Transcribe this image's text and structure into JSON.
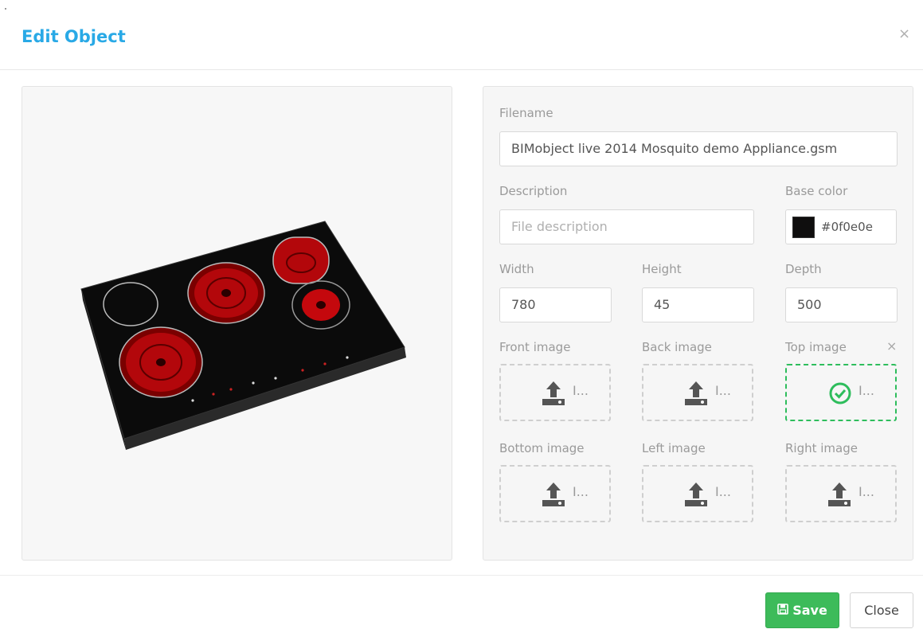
{
  "dialog": {
    "title": "Edit Object",
    "close_glyph": "×"
  },
  "form": {
    "filename_label": "Filename",
    "filename_value": "BIMobject live 2014 Mosquito demo Appliance.gsm",
    "description_label": "Description",
    "description_placeholder": "File description",
    "base_color_label": "Base color",
    "base_color_value": "#0f0e0e",
    "width_label": "Width",
    "width_value": "780",
    "height_label": "Height",
    "height_value": "45",
    "depth_label": "Depth",
    "depth_value": "500"
  },
  "images": [
    {
      "label": "Front image",
      "state": "empty",
      "text": "I..."
    },
    {
      "label": "Back image",
      "state": "empty",
      "text": "I..."
    },
    {
      "label": "Top image",
      "state": "uploaded",
      "text": "I..."
    },
    {
      "label": "Bottom image",
      "state": "empty",
      "text": "I..."
    },
    {
      "label": "Left image",
      "state": "empty",
      "text": "I..."
    },
    {
      "label": "Right image",
      "state": "empty",
      "text": "I..."
    }
  ],
  "remove_glyph": "×",
  "footer": {
    "save_label": "Save",
    "close_label": "Close"
  },
  "colors": {
    "title": "#29a9e6",
    "save_button": "#3dbb5a",
    "uploaded_border": "#2ebd5c"
  },
  "icons": {
    "upload": "upload-icon",
    "check": "check-circle-icon",
    "save": "floppy-disk-icon",
    "close": "close-icon"
  }
}
